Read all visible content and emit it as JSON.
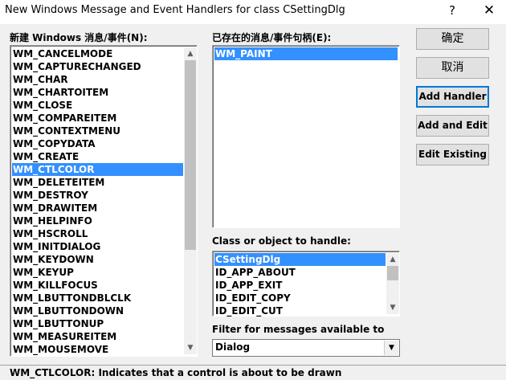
{
  "window": {
    "title": "New Windows Message and Event Handlers for class CSettingDlg",
    "help_glyph": "?",
    "close_glyph": "✕"
  },
  "new_messages": {
    "label": "新建 Windows 消息/事件(N):",
    "items": [
      "WM_CANCELMODE",
      "WM_CAPTURECHANGED",
      "WM_CHAR",
      "WM_CHARTOITEM",
      "WM_CLOSE",
      "WM_COMPAREITEM",
      "WM_CONTEXTMENU",
      "WM_COPYDATA",
      "WM_CREATE",
      "WM_CTLCOLOR",
      "WM_DELETEITEM",
      "WM_DESTROY",
      "WM_DRAWITEM",
      "WM_HELPINFO",
      "WM_HSCROLL",
      "WM_INITDIALOG",
      "WM_KEYDOWN",
      "WM_KEYUP",
      "WM_KILLFOCUS",
      "WM_LBUTTONDBLCLK",
      "WM_LBUTTONDOWN",
      "WM_LBUTTONUP",
      "WM_MEASUREITEM",
      "WM_MOUSEMOVE"
    ],
    "selected": "WM_CTLCOLOR"
  },
  "existing_handlers": {
    "label": "已存在的消息/事件句柄(E):",
    "items": [
      "WM_PAINT"
    ],
    "selected": "WM_PAINT"
  },
  "class_object": {
    "label": "Class or object to handle:",
    "items": [
      "CSettingDlg",
      "ID_APP_ABOUT",
      "ID_APP_EXIT",
      "ID_EDIT_COPY",
      "ID_EDIT_CUT"
    ],
    "selected": "CSettingDlg"
  },
  "filter": {
    "label": "Filter for messages available to",
    "value": "Dialog"
  },
  "buttons": {
    "ok": "确定",
    "cancel": "取消",
    "add_handler": "Add Handler",
    "add_and_edit": "Add and Edit",
    "edit_existing": "Edit Existing"
  },
  "status": {
    "text": "WM_CTLCOLOR:  Indicates that a control is about to be drawn"
  },
  "colors": {
    "selection": "#3390ff",
    "background": "#f0f0f0"
  }
}
